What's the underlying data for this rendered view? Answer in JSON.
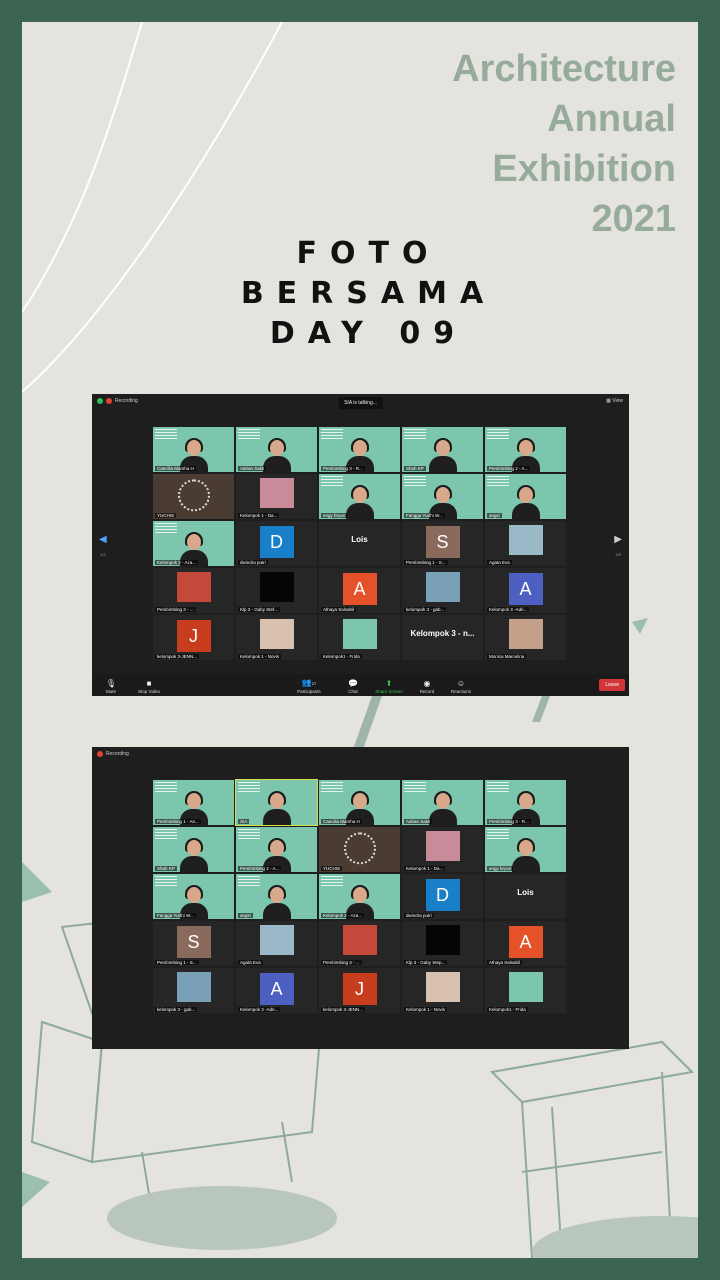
{
  "poster": {
    "title_lines": [
      "Architecture",
      "Annual",
      "Exhibition",
      "2021"
    ],
    "caption_lines": [
      "FOTO",
      "BERSAMA",
      "DAY 09"
    ],
    "colors": {
      "frame": "#3b6551",
      "paper": "#e4e3dd",
      "title": "#96ab9c",
      "accent_tile": "#7cc6ae"
    }
  },
  "screenshot1": {
    "recording_label": "Recording",
    "talking_label": "SIA is talking...",
    "view_label": "View",
    "page_left": "1/3",
    "page_right": "2/3",
    "tiles": [
      {
        "name": "Caecilia Marsha H",
        "kind": "green"
      },
      {
        "name": "Adrian Sakti",
        "kind": "green"
      },
      {
        "name": "Pembimbing 3 - R...",
        "kind": "green"
      },
      {
        "name": "Shah KP",
        "kind": "green"
      },
      {
        "name": "Pembimbing 2 - A...",
        "kind": "green"
      },
      {
        "name": "YUCHIS",
        "kind": "brown"
      },
      {
        "name": "Kelompok 1 - Da...",
        "kind": "photo",
        "color": "#c98a9a"
      },
      {
        "name": "engy bryan",
        "kind": "green"
      },
      {
        "name": "Fangga Yudhi W...",
        "kind": "green"
      },
      {
        "name": "angsi",
        "kind": "green"
      },
      {
        "name": "Kelompok 2 - Aza...",
        "kind": "green"
      },
      {
        "name": "dwindra putri",
        "kind": "avatar",
        "letter": "D",
        "color": "#1a7fc9"
      },
      {
        "name": "",
        "kind": "big",
        "big": "Lois"
      },
      {
        "name": "Pembimbing 1 - S...",
        "kind": "avatar",
        "letter": "S",
        "color": "#8a6a5c"
      },
      {
        "name": "Agata Eva",
        "kind": "photo",
        "color": "#9bb8c8"
      },
      {
        "name": "Pembimbing 3 - ...",
        "kind": "photo",
        "color": "#c5493a"
      },
      {
        "name": "Klp 3 - Gaby Stef...",
        "kind": "photo",
        "color": "#050505"
      },
      {
        "name": "Athaya Salsabil",
        "kind": "avatar",
        "letter": "A",
        "color": "#e5522a"
      },
      {
        "name": "kelompok 3 - gab...",
        "kind": "photo",
        "color": "#7aa0b8"
      },
      {
        "name": "Kelompok 3 -Adri...",
        "kind": "avatar",
        "letter": "A",
        "color": "#4d5fc1"
      },
      {
        "name": "kelompok 3-JENN...",
        "kind": "avatar",
        "letter": "J",
        "color": "#c83d1d"
      },
      {
        "name": "Kelompok 1 - Novis",
        "kind": "photo",
        "color": "#d9c1b0"
      },
      {
        "name": "Kelompok1 - Frida",
        "kind": "photo",
        "color": "#7cc6ae"
      },
      {
        "name": "",
        "kind": "big",
        "big": "Kelompok 3 - n..."
      },
      {
        "name": "Monica Marcelina",
        "kind": "photo",
        "color": "#c4a08a"
      }
    ],
    "toolbar": {
      "mute": "Mute",
      "stop_video": "Stop Video",
      "participants": "Participants",
      "participants_count": "27",
      "chat": "Chat",
      "share": "Share Screen",
      "record": "Record",
      "reactions": "Reactions",
      "leave": "Leave"
    }
  },
  "screenshot2": {
    "recording_label": "Recording",
    "tiles": [
      {
        "name": "Pembimbing 1 - An...",
        "kind": "green"
      },
      {
        "name": "SIA",
        "kind": "green",
        "highlight": true
      },
      {
        "name": "Caecilia Marsha H",
        "kind": "green"
      },
      {
        "name": "Adrian Sakti",
        "kind": "green"
      },
      {
        "name": "Pembimbing 3 - R...",
        "kind": "green"
      },
      {
        "name": "Shah KP",
        "kind": "green"
      },
      {
        "name": "Pembimbing 2 - A...",
        "kind": "green"
      },
      {
        "name": "YUCHIS",
        "kind": "brown"
      },
      {
        "name": "Kelompok 1 - Da...",
        "kind": "photo",
        "color": "#c98a9a"
      },
      {
        "name": "engy bryan",
        "kind": "green"
      },
      {
        "name": "Fangga Yudhi W...",
        "kind": "green"
      },
      {
        "name": "angsi",
        "kind": "green"
      },
      {
        "name": "Kelompok 2 - Aza...",
        "kind": "green"
      },
      {
        "name": "dwindra putri",
        "kind": "avatar",
        "letter": "D",
        "color": "#1a7fc9"
      },
      {
        "name": "",
        "kind": "big",
        "big": "Lois"
      },
      {
        "name": "Pembimbing 1 - S...",
        "kind": "avatar",
        "letter": "S",
        "color": "#8a6a5c"
      },
      {
        "name": "Agata Eva",
        "kind": "photo",
        "color": "#9bb8c8"
      },
      {
        "name": "Pembimbing 3 - ...",
        "kind": "photo",
        "color": "#c5493a"
      },
      {
        "name": "Klp 3 - Gaby Step...",
        "kind": "photo",
        "color": "#050505"
      },
      {
        "name": "Athaya Salsabil",
        "kind": "avatar",
        "letter": "A",
        "color": "#e5522a"
      },
      {
        "name": "kelompok 3 - gab...",
        "kind": "photo",
        "color": "#7aa0b8"
      },
      {
        "name": "Kelompok 3 -Adri...",
        "kind": "avatar",
        "letter": "A",
        "color": "#4d5fc1"
      },
      {
        "name": "kelompok 3-JENN...",
        "kind": "avatar",
        "letter": "J",
        "color": "#c83d1d"
      },
      {
        "name": "Kelompok 1 - Novis",
        "kind": "photo",
        "color": "#d9c1b0"
      },
      {
        "name": "Kelompok1 - Frida",
        "kind": "photo",
        "color": "#7cc6ae"
      }
    ]
  }
}
